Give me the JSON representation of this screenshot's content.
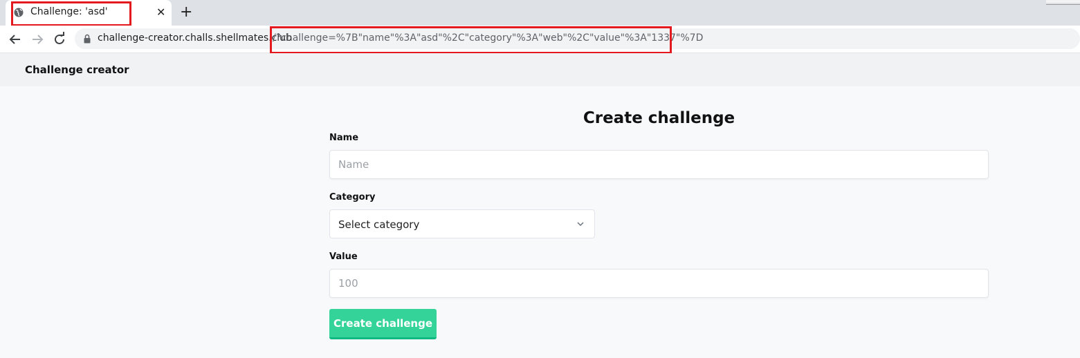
{
  "browser": {
    "tab": {
      "title": "Challenge: 'asd'",
      "close_glyph": "✕",
      "icon": "globe-icon"
    },
    "new_tab_glyph": "+",
    "url_host": "challenge-creator.challs.shellmates.club",
    "url_rest": "/?challenge=%7B\"name\"%3A\"asd\"%2C\"category\"%3A\"web\"%2C\"value\"%3A\"1337\"%7D",
    "highlight_color": "#e3191e"
  },
  "navbar": {
    "brand": "Challenge creator"
  },
  "form": {
    "title": "Create challenge",
    "name_label": "Name",
    "name_placeholder": "Name",
    "category_label": "Category",
    "category_selected": "Select category",
    "value_label": "Value",
    "value_placeholder": "100",
    "submit_label": "Create challenge",
    "accent_color": "#34d399"
  }
}
